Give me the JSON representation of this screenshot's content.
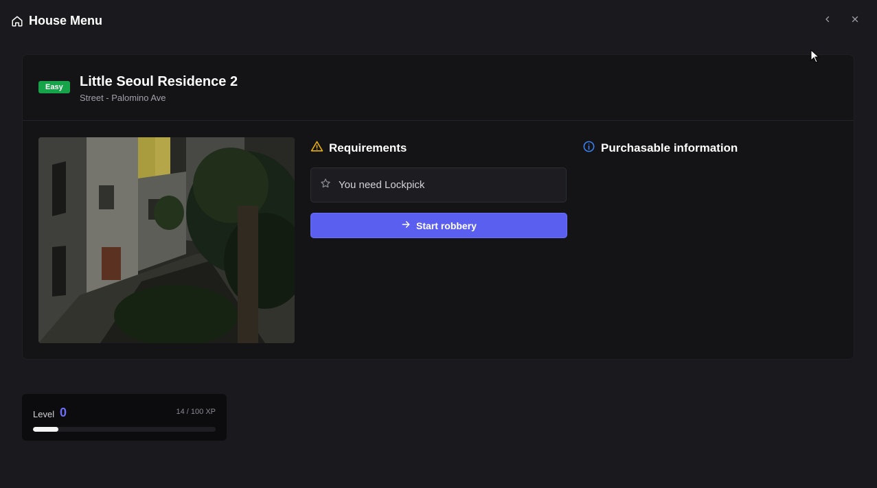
{
  "app": {
    "title": "House Menu"
  },
  "window_controls": {
    "back_icon": "chevron-left-icon",
    "close_icon": "close-icon"
  },
  "house": {
    "difficulty": "Easy",
    "difficulty_color": "#16a34a",
    "name": "Little Seoul Residence 2",
    "street": "Street - Palomino Ave"
  },
  "requirements": {
    "title": "Requirements",
    "icon": "warning-icon",
    "icon_color": "#eab308",
    "items": [
      {
        "icon": "star-icon",
        "text": "You need Lockpick"
      }
    ],
    "start_button": {
      "label": "Start robbery",
      "icon": "arrow-right-icon",
      "color": "#5b5ff0"
    }
  },
  "purchasable": {
    "title": "Purchasable information",
    "icon": "info-icon",
    "icon_color": "#3b82f6"
  },
  "level": {
    "label": "Level",
    "value": "0",
    "xp_text": "14 / 100 XP",
    "xp_progress": 0.14,
    "accent": "#6d6ff7"
  }
}
